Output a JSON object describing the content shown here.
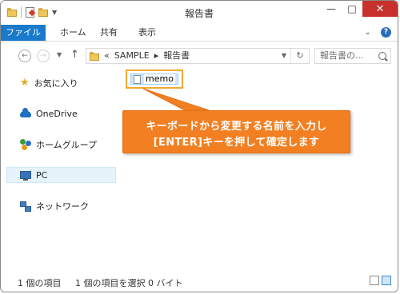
{
  "window": {
    "title": "報告書"
  },
  "ribbon": {
    "file_tab": "ファイル",
    "tabs": [
      "ホーム",
      "共有",
      "表示"
    ]
  },
  "address": {
    "crumbs": [
      "«",
      "SAMPLE",
      "▸",
      "報告書"
    ],
    "search_placeholder": "報告書の..."
  },
  "navpane": {
    "items": [
      {
        "label": "お気に入り",
        "icon": "star-icon"
      },
      {
        "label": "OneDrive",
        "icon": "onedrive-icon"
      },
      {
        "label": "ホームグループ",
        "icon": "homegroup-icon"
      },
      {
        "label": "PC",
        "icon": "pc-icon",
        "selected": true
      },
      {
        "label": "ネットワーク",
        "icon": "network-icon"
      }
    ]
  },
  "content": {
    "file_name": "memo",
    "callout_line1": "キーボードから変更する名前を入力し",
    "callout_line2": "[ENTER]キーを押して確定します"
  },
  "status": {
    "item_count": "1 個の項目",
    "selection": "1 個の項目を選択  0 バイト"
  },
  "colors": {
    "file_tab": "#1979ca",
    "close_button": "#c7302b",
    "callout": "#f28022",
    "highlight_border": "#f0a830"
  }
}
